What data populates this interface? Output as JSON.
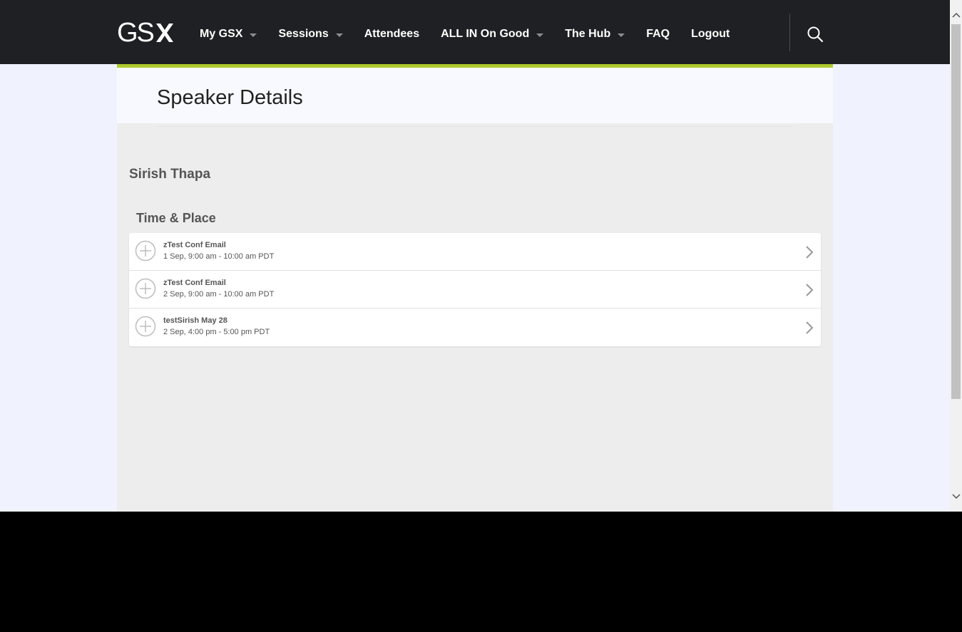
{
  "brand": {
    "logo_text": "GS",
    "logo_mark": "X"
  },
  "nav": {
    "items": [
      {
        "label": "My GSX",
        "has_dropdown": true
      },
      {
        "label": "Sessions",
        "has_dropdown": true
      },
      {
        "label": "Attendees",
        "has_dropdown": false
      },
      {
        "label": "ALL IN On Good",
        "has_dropdown": true
      },
      {
        "label": "The Hub",
        "has_dropdown": true
      },
      {
        "label": "FAQ",
        "has_dropdown": false
      },
      {
        "label": "Logout",
        "has_dropdown": false
      }
    ],
    "search_icon": "search-icon"
  },
  "page": {
    "title": "Speaker Details",
    "speaker_name": "Sirish Thapa",
    "section_title": "Time & Place"
  },
  "sessions": [
    {
      "name": "zTest Conf Email",
      "time": "1 Sep, 9:00 am - 10:00 am PDT"
    },
    {
      "name": "zTest Conf Email",
      "time": "2 Sep, 9:00 am - 10:00 am PDT"
    },
    {
      "name": "testSirish May 28",
      "time": "2 Sep, 4:00 pm - 5:00 pm PDT"
    }
  ],
  "colors": {
    "topbar": "#1f2024",
    "accent": "#aecb2d",
    "background": "#f0f2fd",
    "content": "#ededed"
  }
}
